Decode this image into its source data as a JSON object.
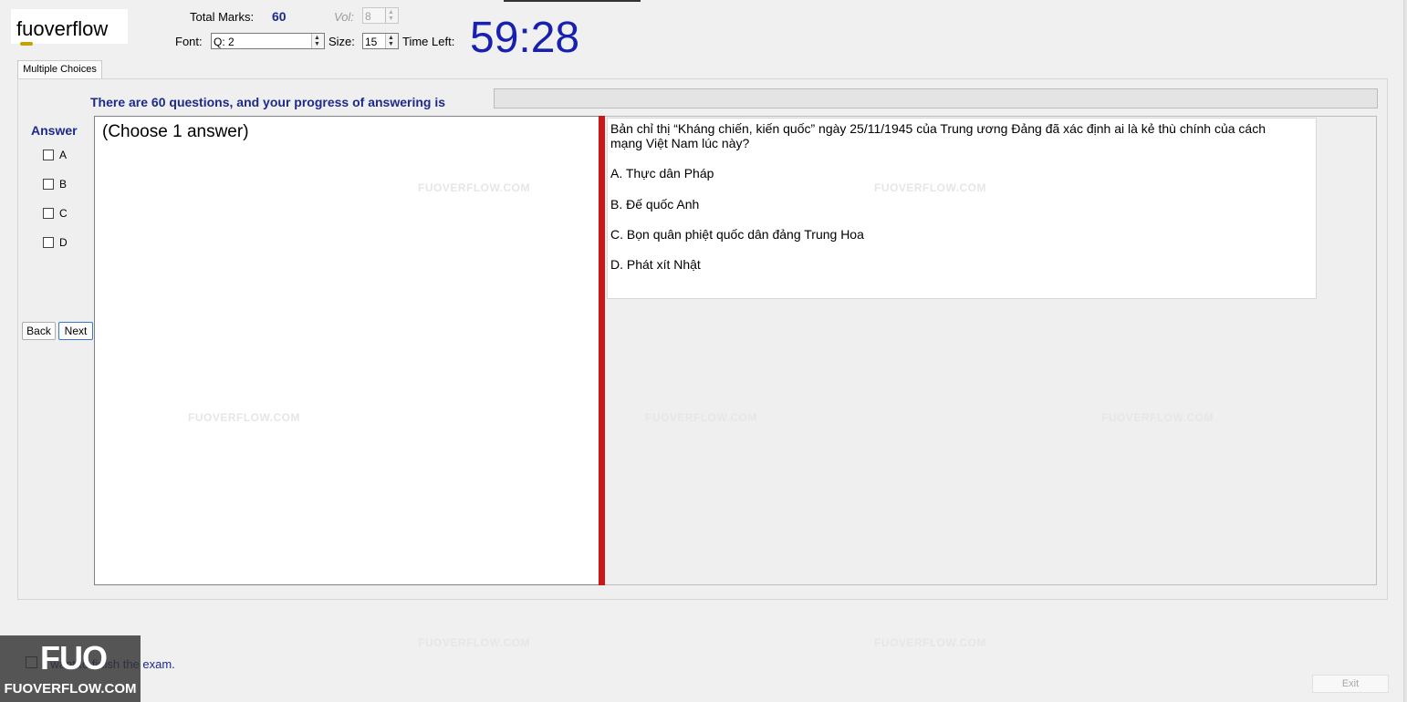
{
  "logo": {
    "text": "fuoverflow"
  },
  "header": {
    "total_marks_label": "Total Marks:",
    "total_marks_value": "60",
    "vol_label": "Vol:",
    "vol_value": "8",
    "font_label": "Font:",
    "font_value": "Q: 2",
    "size_label": "Size:",
    "size_value": "15",
    "time_left_label": "Time Left:",
    "time_left_value": "59:28"
  },
  "tab": {
    "label": "Multiple Choices"
  },
  "progress": {
    "label": "There are 60 questions, and your progress of answering is",
    "fraction": 0.0
  },
  "answer": {
    "title": "Answer",
    "options": [
      "A",
      "B",
      "C",
      "D"
    ],
    "hint": "(Choose 1 answer)"
  },
  "nav": {
    "back_label": "Back",
    "next_label": "Next"
  },
  "question": {
    "text": "Bản chỉ thị “Kháng chiến, kiến quốc” ngày 25/11/1945 của Trung ương Đảng đã xác định ai là kẻ thù chính của cách mạng Việt Nam lúc này?",
    "options": [
      "A.  Thực dân Pháp",
      "B.  Đế quốc Anh",
      "C.  Bọn quân phiệt quốc dân đảng Trung Hoa",
      "D.  Phát xít Nhật"
    ]
  },
  "watermark": {
    "text": "FUOVERFLOW.COM"
  },
  "footer": {
    "finish_label": "I want to finish the exam.",
    "exit_label": "Exit",
    "badge_mark": "FUO",
    "badge_text": "FUOVERFLOW.COM"
  },
  "colors": {
    "accent": "#1d2a8a",
    "timer": "#1820b0",
    "splitter": "#c81818"
  }
}
